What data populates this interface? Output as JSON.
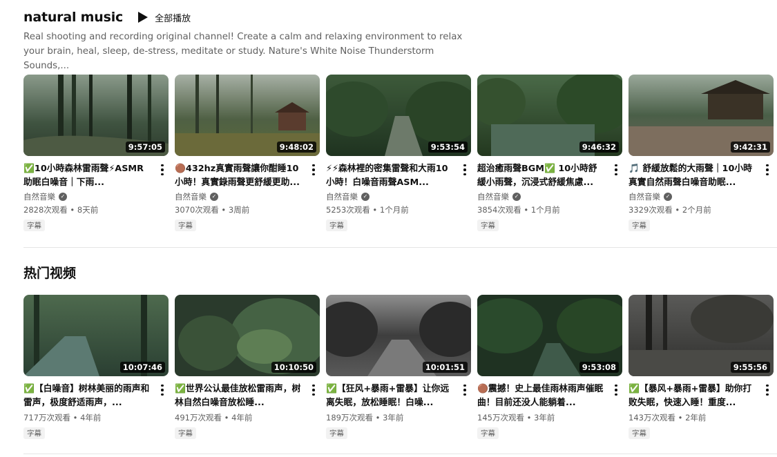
{
  "channel": {
    "title": "natural music",
    "play_all_label": "全部播放",
    "description": "Real shooting and recording original channel! Create a calm and relaxing environment to relax your brain, heal, sleep, de-stress, meditate or study. Nature's White Noise Thunderstorm Sounds,..."
  },
  "recent_videos": [
    {
      "title": "✅10小時森林雷雨聲⚡ASMR助眠白噪音｜下雨...",
      "duration": "9:57:05",
      "author": "自然音樂",
      "views": "2828次观看",
      "age": "8天前",
      "badge": "字幕"
    },
    {
      "title": "🟤432hz真實雨聲讓你酣睡10小時！真實錄雨聲更舒緩更助...",
      "duration": "9:48:02",
      "author": "自然音樂",
      "views": "3070次观看",
      "age": "3周前",
      "badge": "字幕"
    },
    {
      "title": "⚡⚡森林裡的密集雷聲和大雨10小時！白噪音雨聲ASM...",
      "duration": "9:53:54",
      "author": "自然音樂",
      "views": "5253次观看",
      "age": "1个月前",
      "badge": "字幕"
    },
    {
      "title": "超治癒雨聲BGM✅ 10小時舒緩小雨聲，沉浸式舒緩焦慮...",
      "duration": "9:46:32",
      "author": "自然音樂",
      "views": "3854次观看",
      "age": "1个月前",
      "badge": "字幕"
    },
    {
      "title": "🎵 舒緩放鬆的大雨聲｜10小時真實自然雨聲白噪音助眠...",
      "duration": "9:42:31",
      "author": "自然音樂",
      "views": "3329次观看",
      "age": "2个月前",
      "badge": "字幕"
    }
  ],
  "popular": {
    "heading": "热门视频",
    "videos": [
      {
        "title": "✅【白噪音】树林美丽的雨声和雷声，极度舒适雨声，...",
        "duration": "10:07:46",
        "views": "717万次观看",
        "age": "4年前",
        "badge": "字幕"
      },
      {
        "title": "✅世界公认最佳放松雷雨声，树林自然白噪音放松睡...",
        "duration": "10:10:50",
        "views": "491万次观看",
        "age": "4年前",
        "badge": "字幕"
      },
      {
        "title": "✅【狂风+暴雨+雷暴】让你远离失眠，放松睡眠！白噪...",
        "duration": "10:01:51",
        "views": "189万次观看",
        "age": "3年前",
        "badge": "字幕"
      },
      {
        "title": "🟤震撼！史上最佳雨林雨声催眠曲！目前还没人能躺着...",
        "duration": "9:53:08",
        "views": "145万次观看",
        "age": "3年前",
        "badge": "字幕"
      },
      {
        "title": "✅【暴风+暴雨+雷暴】助你打败失眠，快速入睡！重度...",
        "duration": "9:55:56",
        "views": "143万次观看",
        "age": "2年前",
        "badge": "字幕"
      }
    ]
  },
  "colors": {
    "text_primary": "#0f0f0f",
    "text_secondary": "#606060",
    "badge_bg": "#f2f2f2",
    "duration_bg": "#000000"
  },
  "icons": {
    "play_all": "play-icon",
    "menu": "more-vert-icon",
    "verified": "verified-icon"
  }
}
